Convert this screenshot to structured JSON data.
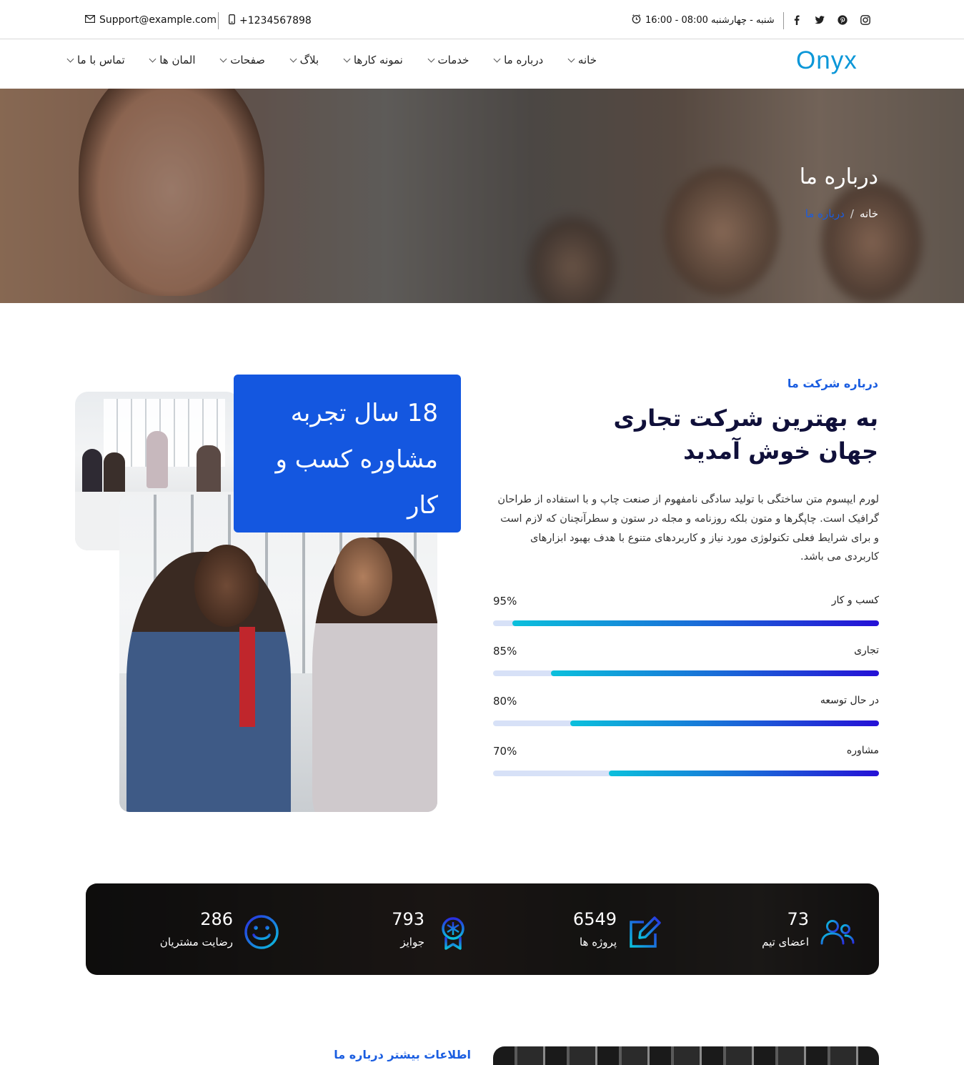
{
  "topbar": {
    "email": "Support@example.com",
    "phone": "+1234567898",
    "hours": "شنبه - چهارشنبه 08:00 - 16:00",
    "social": [
      "facebook-icon",
      "twitter-icon",
      "pinterest-icon",
      "instagram-icon"
    ]
  },
  "nav": {
    "logo": "Onyx",
    "items": [
      {
        "label": "خانه"
      },
      {
        "label": "درباره ما"
      },
      {
        "label": "خدمات"
      },
      {
        "label": "نمونه کارها"
      },
      {
        "label": "بلاگ"
      },
      {
        "label": "صفحات"
      },
      {
        "label": "المان ها"
      },
      {
        "label": "تماس با ما"
      }
    ]
  },
  "hero": {
    "title": "درباره ما",
    "breadcrumb": {
      "home": "خانه",
      "separator": "/",
      "current": "درباره ما"
    }
  },
  "about": {
    "experience": "18 سال تجربه مشاوره کسب و کار",
    "sub_label": "درباره شرکت ما",
    "heading": "به بهترین شرکت تجاری جهان خوش آمدید",
    "paragraph": "لورم ایپسوم متن ساختگی با تولید سادگی نامفهوم از صنعت چاپ و با استفاده از طراحان گرافیک است. چاپگرها و متون بلکه روزنامه و مجله در ستون و سطرآنچنان که لازم است و برای شرایط فعلی تکنولوژی مورد نیاز و کاربردهای متنوع با هدف بهبود ابزارهای کاربردی می باشد.",
    "skills": [
      {
        "label": "کسب و کار",
        "percent_text": "95%",
        "percent": 95
      },
      {
        "label": "تجاری",
        "percent_text": "85%",
        "percent": 85
      },
      {
        "label": "در حال توسعه",
        "percent_text": "80%",
        "percent": 80
      },
      {
        "label": "مشاوره",
        "percent_text": "70%",
        "percent": 70
      }
    ]
  },
  "stats": [
    {
      "value": "73",
      "label": "اعضای تیم",
      "icon": "team-icon"
    },
    {
      "value": "6549",
      "label": "پروژه ها",
      "icon": "edit-icon"
    },
    {
      "value": "793",
      "label": "جوایز",
      "icon": "award-icon"
    },
    {
      "value": "286",
      "label": "رضایت مشتریان",
      "icon": "smile-icon"
    }
  ],
  "more": {
    "label": "اطلاعات بیشتر درباره ما"
  },
  "colors": {
    "accent": "#1a5de0",
    "logo": "#0c97d8",
    "heading": "#10103a"
  }
}
